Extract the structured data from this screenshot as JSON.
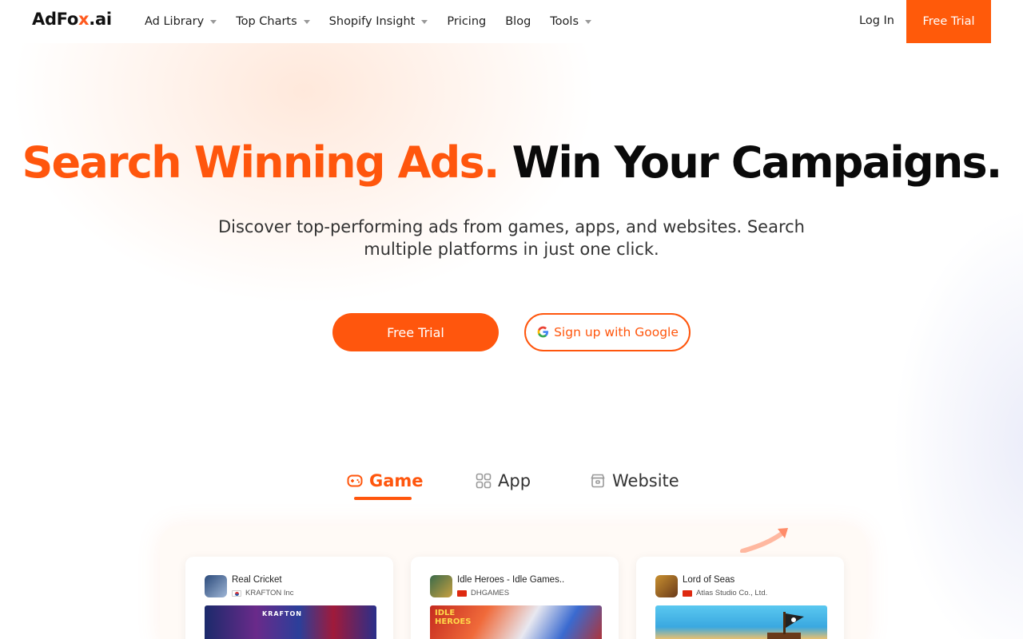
{
  "nav": {
    "logo": {
      "pre": "AdF",
      "mid": "o",
      "x": "x",
      "post": ".ai"
    },
    "items": [
      {
        "label": "Ad Library",
        "dropdown": true
      },
      {
        "label": "Top Charts",
        "dropdown": true
      },
      {
        "label": "Shopify Insight",
        "dropdown": true
      },
      {
        "label": "Pricing",
        "dropdown": false
      },
      {
        "label": "Blog",
        "dropdown": false
      },
      {
        "label": "Tools",
        "dropdown": true
      }
    ],
    "login": "Log In",
    "trial": "Free Trial"
  },
  "hero": {
    "title_orange": "Search Winning Ads.",
    "title_dark": "Win Your Campaigns.",
    "subtitle": "Discover top-performing ads from games, apps, and websites. Search multiple platforms in just one click.",
    "cta_trial": "Free Trial",
    "cta_google": "Sign up with Google"
  },
  "tabs": [
    {
      "label": "Game",
      "icon": "gamepad-icon",
      "active": true
    },
    {
      "label": "App",
      "icon": "grid-icon",
      "active": false
    },
    {
      "label": "Website",
      "icon": "store-icon",
      "active": false
    }
  ],
  "cards": [
    {
      "name": "Real Cricket",
      "publisher": "KRAFTON Inc",
      "flag": "kr",
      "thumb_text": "KRAFTON"
    },
    {
      "name": "Idle Heroes - Idle Games..",
      "publisher": "DHGAMES",
      "flag": "cn",
      "thumb_text": "IDLE HEROES"
    },
    {
      "name": "Lord of Seas",
      "publisher": "Atlas Studio Co., Ltd.",
      "flag": "cn",
      "thumb_text": ""
    }
  ],
  "colors": {
    "accent": "#ff560d",
    "text_dark": "#0a0a0a"
  }
}
